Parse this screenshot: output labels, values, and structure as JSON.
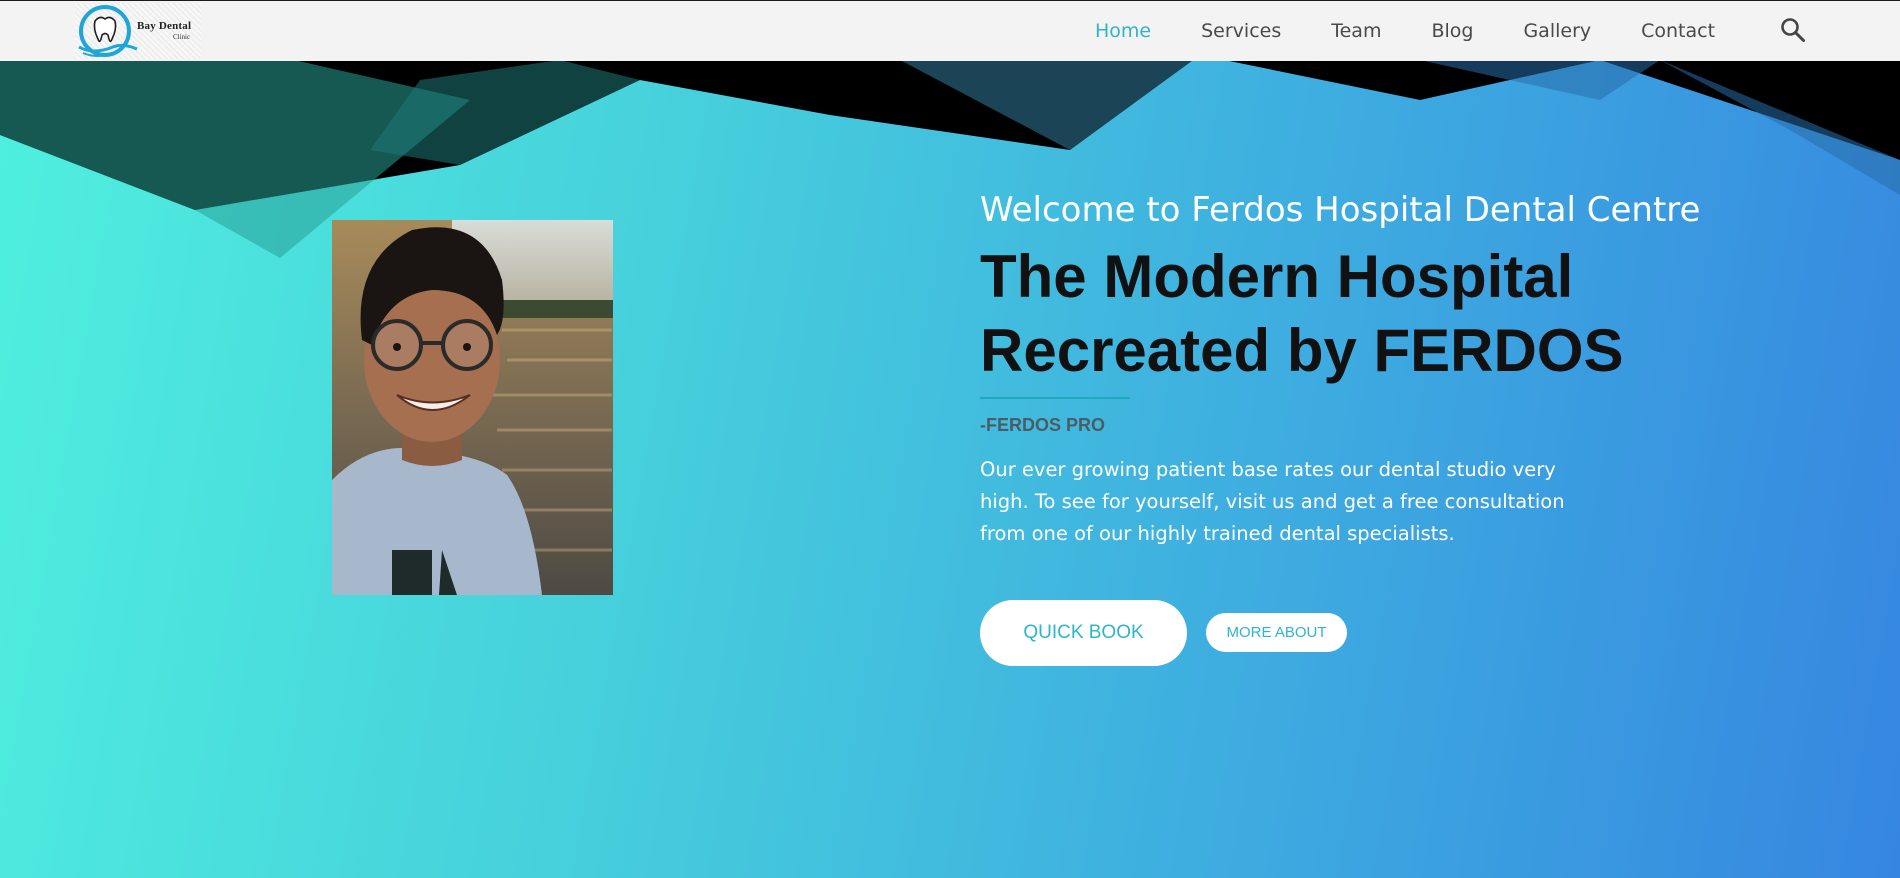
{
  "brand": {
    "logo_text": "Bay Dental",
    "logo_sub": "Clinic"
  },
  "nav": {
    "items": [
      {
        "label": "Home",
        "active": true
      },
      {
        "label": "Services",
        "active": false
      },
      {
        "label": "Team",
        "active": false
      },
      {
        "label": "Blog",
        "active": false
      },
      {
        "label": "Gallery",
        "active": false
      },
      {
        "label": "Contact",
        "active": false
      }
    ],
    "search_icon": "search-icon"
  },
  "hero": {
    "welcome": "Welcome to Ferdos Hospital Dental Centre",
    "headline_line1": "The Modern Hospital",
    "headline_line2": "Recreated by FERDOS",
    "byline": "-FERDOS PRO",
    "description": "Our ever growing patient base rates our dental studio very high. To see for yourself, visit us and get a free consultation from one of our highly trained dental specialists.",
    "primary_button": "QUICK BOOK",
    "secondary_button": "MORE ABOUT"
  },
  "colors": {
    "accent": "#2fb5c9",
    "gradient_start": "#4ff0de",
    "gradient_end": "#3686e0",
    "headline": "#111111",
    "nav_bg": "#f3f3f3"
  }
}
